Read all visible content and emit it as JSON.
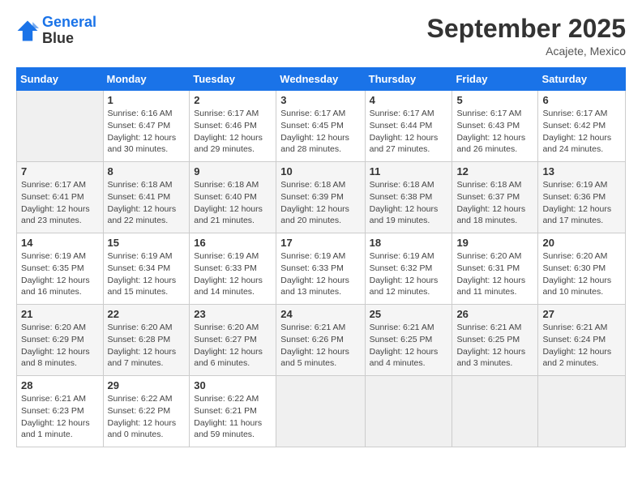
{
  "logo": {
    "line1": "General",
    "line2": "Blue"
  },
  "header": {
    "month": "September 2025",
    "location": "Acajete, Mexico"
  },
  "days_of_week": [
    "Sunday",
    "Monday",
    "Tuesday",
    "Wednesday",
    "Thursday",
    "Friday",
    "Saturday"
  ],
  "weeks": [
    [
      {
        "day": "",
        "details": ""
      },
      {
        "day": "1",
        "details": "Sunrise: 6:16 AM\nSunset: 6:47 PM\nDaylight: 12 hours\nand 30 minutes."
      },
      {
        "day": "2",
        "details": "Sunrise: 6:17 AM\nSunset: 6:46 PM\nDaylight: 12 hours\nand 29 minutes."
      },
      {
        "day": "3",
        "details": "Sunrise: 6:17 AM\nSunset: 6:45 PM\nDaylight: 12 hours\nand 28 minutes."
      },
      {
        "day": "4",
        "details": "Sunrise: 6:17 AM\nSunset: 6:44 PM\nDaylight: 12 hours\nand 27 minutes."
      },
      {
        "day": "5",
        "details": "Sunrise: 6:17 AM\nSunset: 6:43 PM\nDaylight: 12 hours\nand 26 minutes."
      },
      {
        "day": "6",
        "details": "Sunrise: 6:17 AM\nSunset: 6:42 PM\nDaylight: 12 hours\nand 24 minutes."
      }
    ],
    [
      {
        "day": "7",
        "details": "Sunrise: 6:17 AM\nSunset: 6:41 PM\nDaylight: 12 hours\nand 23 minutes."
      },
      {
        "day": "8",
        "details": "Sunrise: 6:18 AM\nSunset: 6:41 PM\nDaylight: 12 hours\nand 22 minutes."
      },
      {
        "day": "9",
        "details": "Sunrise: 6:18 AM\nSunset: 6:40 PM\nDaylight: 12 hours\nand 21 minutes."
      },
      {
        "day": "10",
        "details": "Sunrise: 6:18 AM\nSunset: 6:39 PM\nDaylight: 12 hours\nand 20 minutes."
      },
      {
        "day": "11",
        "details": "Sunrise: 6:18 AM\nSunset: 6:38 PM\nDaylight: 12 hours\nand 19 minutes."
      },
      {
        "day": "12",
        "details": "Sunrise: 6:18 AM\nSunset: 6:37 PM\nDaylight: 12 hours\nand 18 minutes."
      },
      {
        "day": "13",
        "details": "Sunrise: 6:19 AM\nSunset: 6:36 PM\nDaylight: 12 hours\nand 17 minutes."
      }
    ],
    [
      {
        "day": "14",
        "details": "Sunrise: 6:19 AM\nSunset: 6:35 PM\nDaylight: 12 hours\nand 16 minutes."
      },
      {
        "day": "15",
        "details": "Sunrise: 6:19 AM\nSunset: 6:34 PM\nDaylight: 12 hours\nand 15 minutes."
      },
      {
        "day": "16",
        "details": "Sunrise: 6:19 AM\nSunset: 6:33 PM\nDaylight: 12 hours\nand 14 minutes."
      },
      {
        "day": "17",
        "details": "Sunrise: 6:19 AM\nSunset: 6:33 PM\nDaylight: 12 hours\nand 13 minutes."
      },
      {
        "day": "18",
        "details": "Sunrise: 6:19 AM\nSunset: 6:32 PM\nDaylight: 12 hours\nand 12 minutes."
      },
      {
        "day": "19",
        "details": "Sunrise: 6:20 AM\nSunset: 6:31 PM\nDaylight: 12 hours\nand 11 minutes."
      },
      {
        "day": "20",
        "details": "Sunrise: 6:20 AM\nSunset: 6:30 PM\nDaylight: 12 hours\nand 10 minutes."
      }
    ],
    [
      {
        "day": "21",
        "details": "Sunrise: 6:20 AM\nSunset: 6:29 PM\nDaylight: 12 hours\nand 8 minutes."
      },
      {
        "day": "22",
        "details": "Sunrise: 6:20 AM\nSunset: 6:28 PM\nDaylight: 12 hours\nand 7 minutes."
      },
      {
        "day": "23",
        "details": "Sunrise: 6:20 AM\nSunset: 6:27 PM\nDaylight: 12 hours\nand 6 minutes."
      },
      {
        "day": "24",
        "details": "Sunrise: 6:21 AM\nSunset: 6:26 PM\nDaylight: 12 hours\nand 5 minutes."
      },
      {
        "day": "25",
        "details": "Sunrise: 6:21 AM\nSunset: 6:25 PM\nDaylight: 12 hours\nand 4 minutes."
      },
      {
        "day": "26",
        "details": "Sunrise: 6:21 AM\nSunset: 6:25 PM\nDaylight: 12 hours\nand 3 minutes."
      },
      {
        "day": "27",
        "details": "Sunrise: 6:21 AM\nSunset: 6:24 PM\nDaylight: 12 hours\nand 2 minutes."
      }
    ],
    [
      {
        "day": "28",
        "details": "Sunrise: 6:21 AM\nSunset: 6:23 PM\nDaylight: 12 hours\nand 1 minute."
      },
      {
        "day": "29",
        "details": "Sunrise: 6:22 AM\nSunset: 6:22 PM\nDaylight: 12 hours\nand 0 minutes."
      },
      {
        "day": "30",
        "details": "Sunrise: 6:22 AM\nSunset: 6:21 PM\nDaylight: 11 hours\nand 59 minutes."
      },
      {
        "day": "",
        "details": ""
      },
      {
        "day": "",
        "details": ""
      },
      {
        "day": "",
        "details": ""
      },
      {
        "day": "",
        "details": ""
      }
    ]
  ]
}
